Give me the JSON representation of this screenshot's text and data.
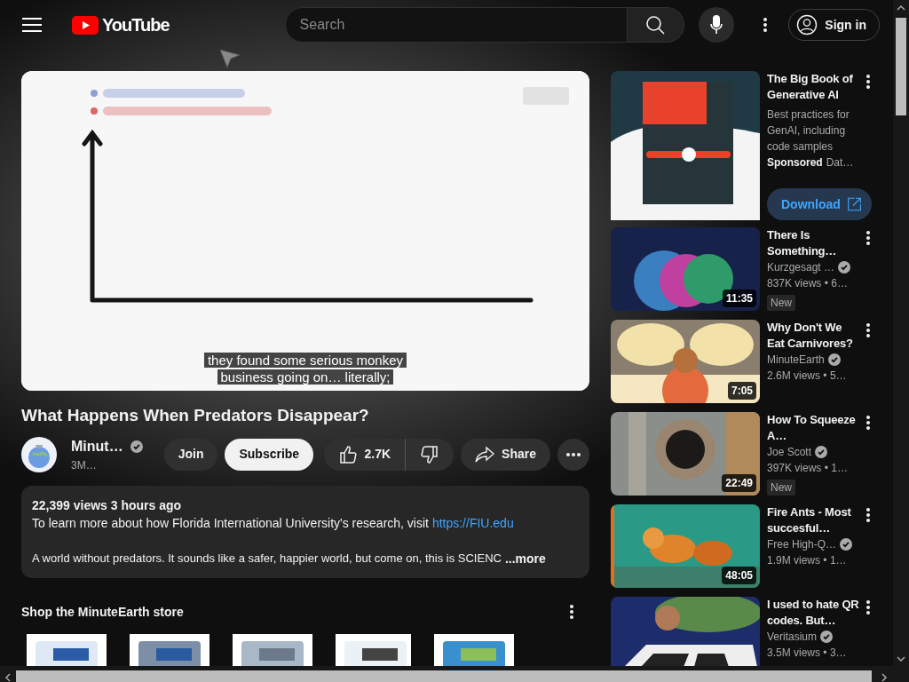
{
  "header": {
    "logo": "YouTube",
    "search_placeholder": "Search",
    "sign_in": "Sign in"
  },
  "player": {
    "captions": [
      "they found some serious monkey",
      "business going on… literally;"
    ]
  },
  "video": {
    "title": "What Happens When Predators Disappear?",
    "channel": {
      "name": "Minut…",
      "verified": true,
      "subscribers": "3M…"
    },
    "join": "Join",
    "subscribe": "Subscribe",
    "likes": "2.7K",
    "share": "Share"
  },
  "description": {
    "stats": "22,399 views  3 hours ago",
    "line1": "To learn more about how Florida International University's research, visit",
    "link": "https://FIU.edu",
    "line2": "A world without predators. It sounds like a safer, happier world, but come on, this is SCIENC",
    "more": "...more"
  },
  "shop": {
    "title": "Shop the MinuteEarth store"
  },
  "related": [
    {
      "kind": "ad",
      "title": "The Big Book of Generative AI",
      "text": "Best practices for GenAI, including code samples",
      "sponsored": "Sponsored",
      "advertiser": "Dat…",
      "button": "Download"
    },
    {
      "kind": "video",
      "title": "There Is Something…",
      "channel": "Kurzgesagt …",
      "verified": true,
      "meta": "837K views • 6…",
      "new": "New",
      "duration": "11:35"
    },
    {
      "kind": "video",
      "title": "Why Don't We Eat Carnivores?",
      "channel": "MinuteEarth",
      "verified": true,
      "meta": "2.6M views • 5…",
      "duration": "7:05"
    },
    {
      "kind": "video",
      "title": "How To Squeeze A…",
      "channel": "Joe Scott",
      "verified": true,
      "meta": "397K views • 1…",
      "new": "New",
      "duration": "22:49"
    },
    {
      "kind": "video",
      "title": "Fire Ants - Most succesful…",
      "channel": "Free High-Q…",
      "verified": true,
      "meta": "1.9M views • 1…",
      "duration": "48:05"
    },
    {
      "kind": "video",
      "title": "I used to hate QR codes. But…",
      "channel": "Veritasium",
      "verified": true,
      "meta": "3.5M views • 3…"
    }
  ]
}
